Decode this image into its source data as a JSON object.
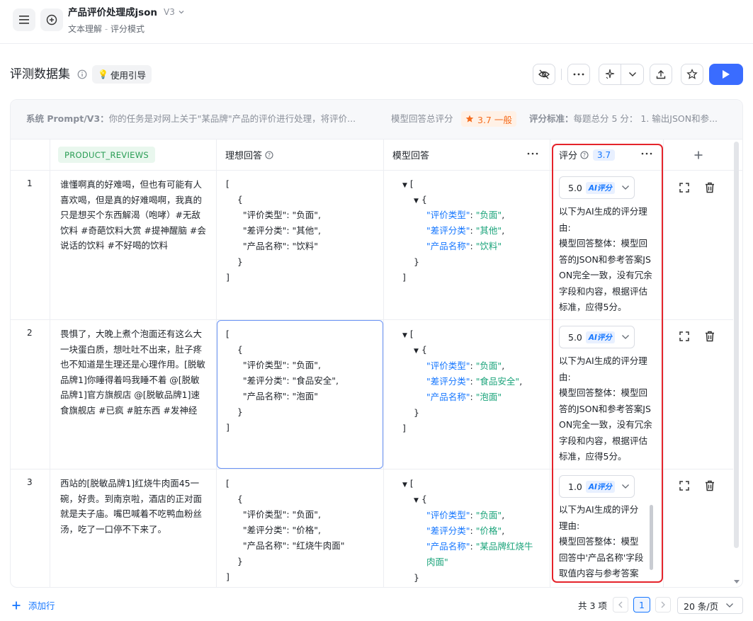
{
  "header": {
    "title": "产品评价处理成json",
    "version": "V3",
    "breadcrumb_a": "文本理解",
    "breadcrumb_sep": "-",
    "breadcrumb_b": "评分模式"
  },
  "toolbar": {
    "section_title": "评测数据集",
    "guide_label": "使用引导"
  },
  "info_bar": {
    "system_prompt_label": "系统 Prompt/V3：",
    "system_prompt_text": "你的任务是对网上关于\"某品牌\"产品的评价进行处理，将评价...",
    "total_score_label": "模型回答总评分",
    "total_score_value": "3.7 一般",
    "criteria_label": "评分标准：",
    "criteria_text": "每题总分 5 分：  1. 输出JSON和参..."
  },
  "table": {
    "col_input": "PRODUCT_REVIEWS",
    "col_ideal": "理想回答",
    "col_model": "模型回答",
    "col_score": "评分",
    "col_score_avg": "3.7",
    "rows": [
      {
        "index": "1",
        "review": "谁懂啊真的好难喝，但也有可能有人喜欢喝，但是真的好难喝啊，我真的只是想买个东西解渴（咆哮）#无敌饮料 #奇葩饮料大赏 #提神醒脑 #会说话的饮料 #不好喝的饮料",
        "ideal_lines": [
          "[",
          "    {",
          "      \"评价类型\": \"负面\",",
          "      \"差评分类\": \"其他\",",
          "      \"产品名称\": \"饮料\"",
          "    }",
          "]"
        ],
        "model": {
          "k1": "\"评价类型\"",
          "v1": "\"负面\"",
          "k2": "\"差评分类\"",
          "v2": "\"其他\"",
          "k3": "\"产品名称\"",
          "v3": "\"饮料\""
        },
        "score": "5.0",
        "ai_tag": "AI评分",
        "reason_title": "以下为AI生成的评分理由:",
        "reason_body": "模型回答整体：模型回答的JSON和参考答案JSON完全一致，没有冗余字段和内容，根据评估标准，应得5分。"
      },
      {
        "index": "2",
        "review": "畏惧了，大晚上煮个泡面还有这么大一块蛋白质，想吐吐不出来，肚子疼也不知道是生理还是心理作用。[脱敏品牌1]你睡得着吗我睡不着 @[脱敏品牌1]官方旗舰店 @[脱敏品牌1]速食旗舰店 #已疯 #脏东西 #发神经",
        "ideal_lines": [
          "[",
          "    {",
          "      \"评价类型\": \"负面\",",
          "      \"差评分类\": \"食品安全\",",
          "      \"产品名称\": \"泡面\"",
          "    }",
          "]"
        ],
        "model": {
          "k1": "\"评价类型\"",
          "v1": "\"负面\"",
          "k2": "\"差评分类\"",
          "v2": "\"食品安全\"",
          "k3": "\"产品名称\"",
          "v3": "\"泡面\""
        },
        "score": "5.0",
        "ai_tag": "AI评分",
        "reason_title": "以下为AI生成的评分理由:",
        "reason_body": "模型回答整体：模型回答的JSON和参考答案JSON完全一致，没有冗余字段和内容，根据评估标准，应得5分。"
      },
      {
        "index": "3",
        "review": "西站的[脱敏品牌1]红烧牛肉面45一碗，好贵。到南京啦，酒店的正对面就是夫子庙。嘴巴喊着不吃鸭血粉丝汤，吃了一口停不下来了。",
        "ideal_lines": [
          "[",
          "    {",
          "      \"评价类型\": \"负面\",",
          "      \"差评分类\": \"价格\",",
          "      \"产品名称\": \"红烧牛肉面\"",
          "    }",
          "]"
        ],
        "model": {
          "k1": "\"评价类型\"",
          "v1": "\"负面\"",
          "k2": "\"差评分类\"",
          "v2": "\"价格\"",
          "k3": "\"产品名称\"",
          "v3": "\"某品牌红烧牛肉面\""
        },
        "score": "1.0",
        "ai_tag": "AI评分",
        "reason_title": "以下为AI生成的评分理由:",
        "reason_body": "模型回答整体：模型回答中'产品名称'字段取值内容与参考答案不一致，参考答案"
      }
    ]
  },
  "footer": {
    "add_row": "添加行",
    "total": "共 3 项",
    "page": "1",
    "page_size": "20 条/页"
  },
  "colors": {
    "accent": "#1677ff",
    "highlight_border": "#e5242b",
    "score_badge_bg": "#fff1e6",
    "score_badge_fg": "#f56c1d"
  }
}
